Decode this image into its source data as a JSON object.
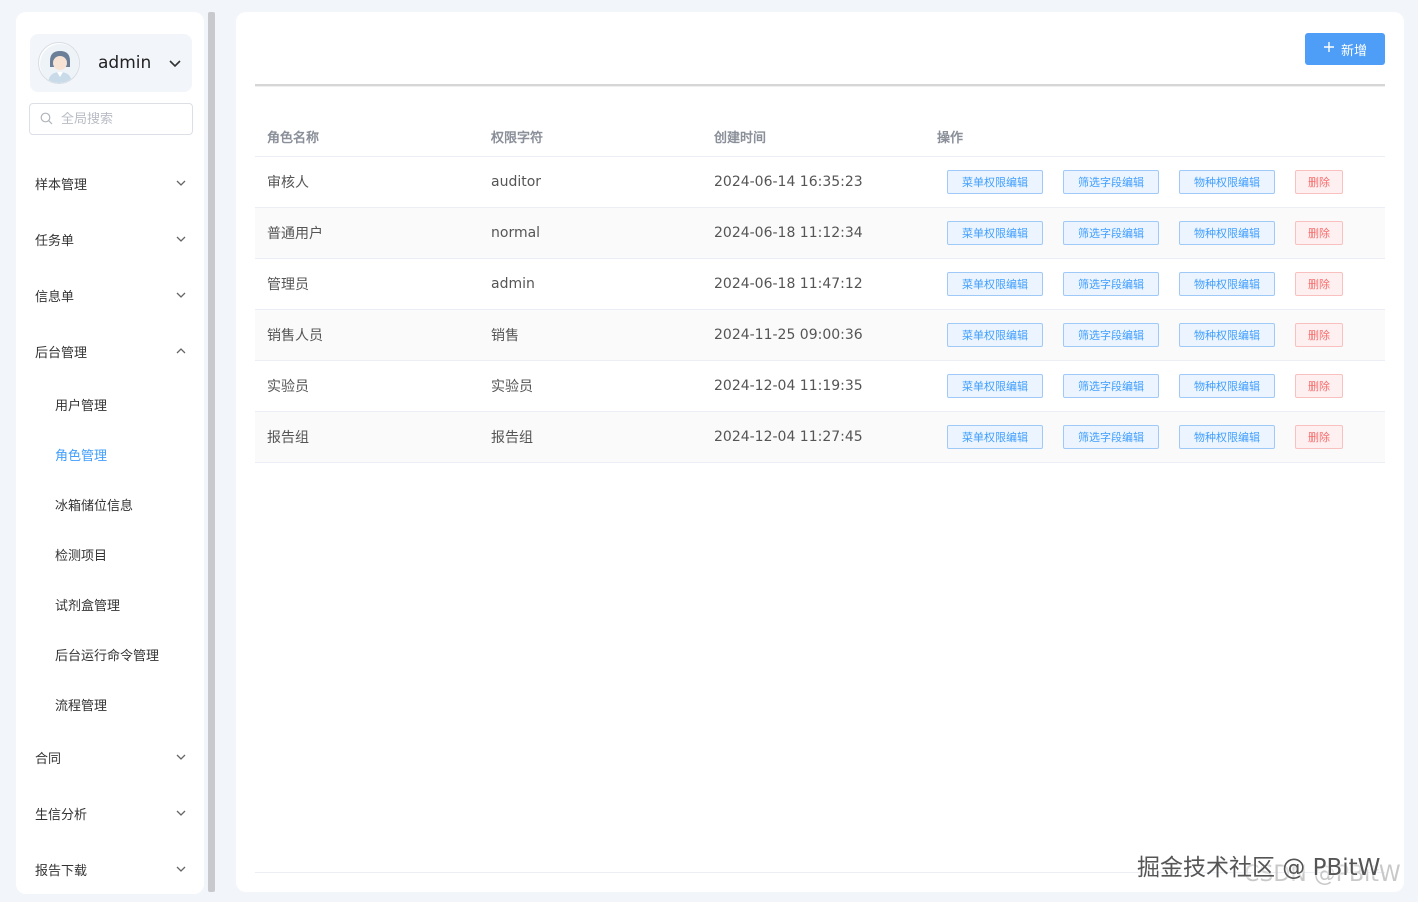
{
  "user": {
    "name": "admin",
    "avatar_icon": "user-avatar-icon"
  },
  "search": {
    "placeholder": "全局搜索"
  },
  "menu": {
    "top_items": [
      {
        "label": "样本管理",
        "expanded": false
      },
      {
        "label": "任务单",
        "expanded": false
      },
      {
        "label": "信息单",
        "expanded": false
      },
      {
        "label": "后台管理",
        "expanded": true
      }
    ],
    "sub_items": [
      {
        "label": "用户管理",
        "active": false
      },
      {
        "label": "角色管理",
        "active": true
      },
      {
        "label": "冰箱储位信息",
        "active": false
      },
      {
        "label": "检测项目",
        "active": false
      },
      {
        "label": "试剂盒管理",
        "active": false
      },
      {
        "label": "后台运行命令管理",
        "active": false
      },
      {
        "label": "流程管理",
        "active": false
      }
    ],
    "bottom_items": [
      {
        "label": "合同",
        "expanded": false
      },
      {
        "label": "生信分析",
        "expanded": false
      },
      {
        "label": "报告下载",
        "expanded": false
      }
    ]
  },
  "toolbar": {
    "add_label": "新增"
  },
  "table": {
    "headers": [
      "角色名称",
      "权限字符",
      "创建时间",
      "操作"
    ],
    "rows": [
      {
        "name": "审核人",
        "key": "auditor",
        "created": "2024-06-14 16:35:23"
      },
      {
        "name": "普通用户",
        "key": "normal",
        "created": "2024-06-18 11:12:34"
      },
      {
        "name": "管理员",
        "key": "admin",
        "created": "2024-06-18 11:47:12"
      },
      {
        "name": "销售人员",
        "key": "销售",
        "created": "2024-11-25 09:00:36"
      },
      {
        "name": "实验员",
        "key": "实验员",
        "created": "2024-12-04 11:19:35"
      },
      {
        "name": "报告组",
        "key": "报告组",
        "created": "2024-12-04 11:27:45"
      }
    ],
    "actions": {
      "menu_edit": "菜单权限编辑",
      "filter_edit": "筛选字段编辑",
      "species_edit": "物种权限编辑",
      "delete": "删除"
    }
  },
  "colors": {
    "primary": "#409eff",
    "danger": "#f56c6c",
    "active_menu": "#409eff"
  },
  "watermark": {
    "text": "掘金技术社区 @ PBitW",
    "ghost_text": "CSDN @PBitW"
  }
}
